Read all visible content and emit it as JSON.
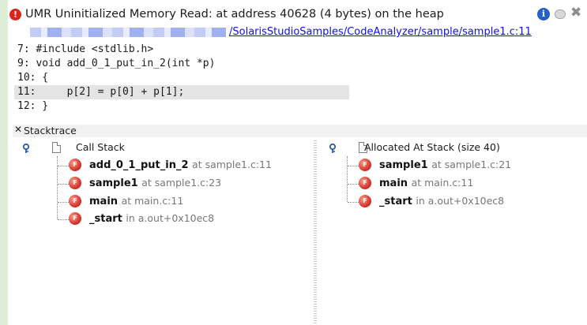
{
  "header": {
    "error_icon_glyph": "!",
    "title": "UMR Uninitialized Memory Read: at address 40628 (4 bytes) on the heap",
    "info_icon_glyph": "i",
    "close_glyph": "✖"
  },
  "path": {
    "link": "/SolarisStudioSamples/CodeAnalyzer/sample/sample1.c:11"
  },
  "code": {
    "lines": [
      "7: #include <stdlib.h>",
      "9: void add_0_1_put_in_2(int *p)",
      "10: {",
      "11:     p[2] = p[0] + p[1];",
      "12: }"
    ],
    "highlighted_line_index": 3
  },
  "stacktrace": {
    "toggle_glyph": "✕",
    "label": "Stacktrace"
  },
  "call_stack": {
    "label": "Call Stack",
    "frames": [
      {
        "name": "add_0_1_put_in_2",
        "loc": "at sample1.c:11"
      },
      {
        "name": "sample1",
        "loc": "at sample1.c:23"
      },
      {
        "name": "main",
        "loc": "at main.c:11"
      },
      {
        "name": "_start",
        "loc": "in a.out+0x10ec8"
      }
    ]
  },
  "alloc_stack": {
    "label": "Allocated At Stack (size 40)",
    "frames": [
      {
        "name": "sample1",
        "loc": "at sample1.c:21"
      },
      {
        "name": "main",
        "loc": "at main.c:11"
      },
      {
        "name": "_start",
        "loc": "in a.out+0x10ec8"
      }
    ]
  },
  "icons": {
    "error": "error-icon",
    "info": "info-icon",
    "minimize": "minimize-icon",
    "close": "close-icon",
    "key": "key-icon",
    "document": "document-icon",
    "function": "function-icon"
  },
  "colors": {
    "accent_link": "#0e0ee6",
    "error": "#d9261c",
    "info": "#2660c9",
    "gutter": "#dfeed6",
    "highlight": "#e4e4e4"
  }
}
